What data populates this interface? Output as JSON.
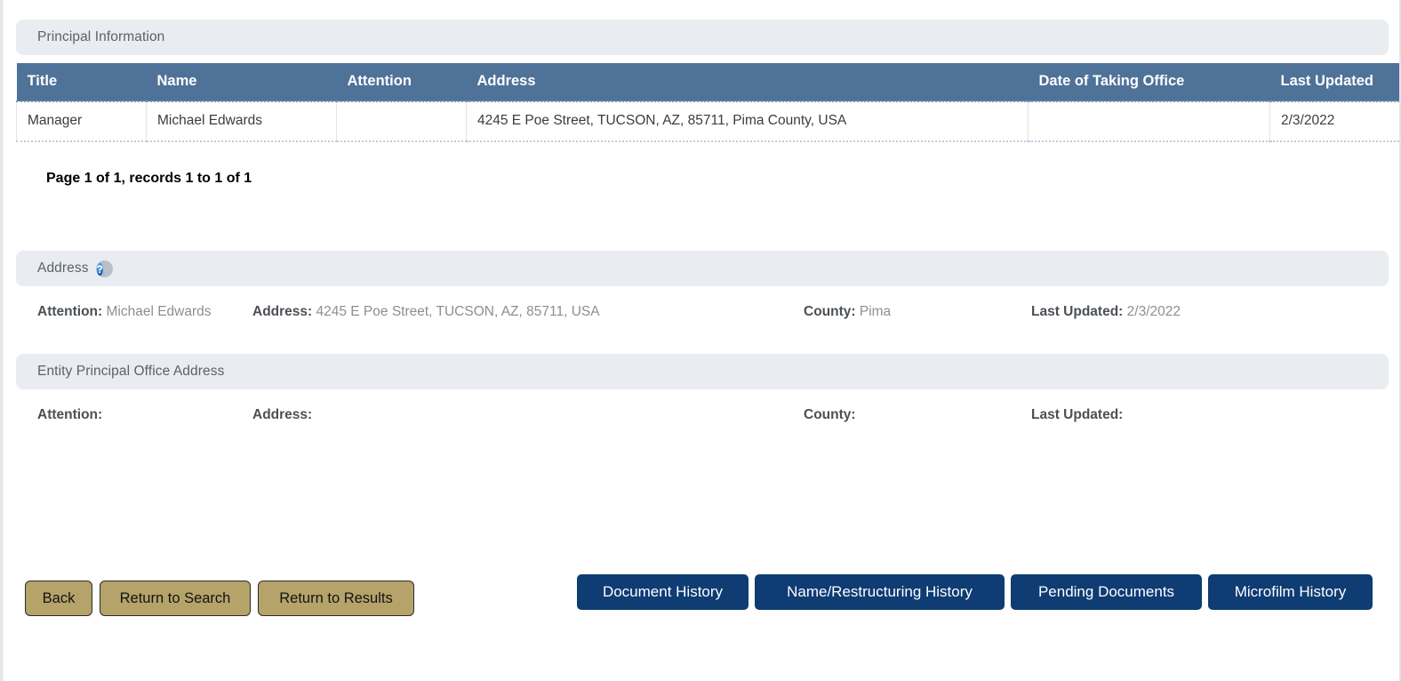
{
  "sections": {
    "principal_information": {
      "title": "Principal Information"
    },
    "address": {
      "title": "Address",
      "help_icon": "help-circle-icon"
    },
    "entity_principal_office_address": {
      "title": "Entity Principal Office Address"
    }
  },
  "principal_table": {
    "columns": [
      "Title",
      "Name",
      "Attention",
      "Address",
      "Date of Taking Office",
      "Last Updated"
    ],
    "rows": [
      {
        "title": "Manager",
        "name": "Michael Edwards",
        "attention": "",
        "address": "4245 E Poe Street, TUCSON, AZ, 85711, Pima County, USA",
        "date_of_taking_office": "",
        "last_updated": "2/3/2022"
      }
    ]
  },
  "pagination": {
    "text": "Page 1 of 1, records 1 to 1 of 1"
  },
  "address_details": {
    "attention_label": "Attention:",
    "attention_value": "Michael Edwards",
    "address_label": "Address:",
    "address_value": "4245 E Poe Street, TUCSON, AZ, 85711, USA",
    "county_label": "County:",
    "county_value": "Pima",
    "last_updated_label": "Last Updated:",
    "last_updated_value": "2/3/2022"
  },
  "entity_office_details": {
    "attention_label": "Attention:",
    "attention_value": "",
    "address_label": "Address:",
    "address_value": "",
    "county_label": "County:",
    "county_value": "",
    "last_updated_label": "Last Updated:",
    "last_updated_value": ""
  },
  "footer": {
    "left_buttons": [
      {
        "label": "Back"
      },
      {
        "label": "Return to Search"
      },
      {
        "label": "Return to Results"
      }
    ],
    "right_buttons": [
      {
        "label": "Document History"
      },
      {
        "label": "Name/Restructuring History"
      },
      {
        "label": "Pending Documents"
      },
      {
        "label": "Microfilm History"
      }
    ]
  },
  "colors": {
    "table_header_blue": "#4f7299",
    "section_bar_gray": "#e9edf2",
    "tan_button": "#b5a36a",
    "navy_button": "#0e3c73",
    "help_icon_blue": "#2a7fd4"
  }
}
